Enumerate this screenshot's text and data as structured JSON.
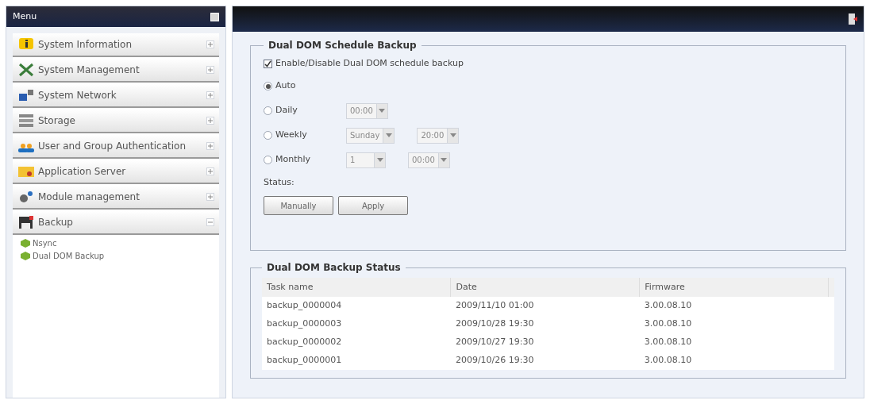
{
  "menu": {
    "title": "Menu",
    "items": [
      {
        "label": "System Information",
        "kind": "info",
        "expanded": false
      },
      {
        "label": "System Management",
        "kind": "tools",
        "expanded": false
      },
      {
        "label": "System Network",
        "kind": "network",
        "expanded": false
      },
      {
        "label": "Storage",
        "kind": "storage",
        "expanded": false
      },
      {
        "label": "User and Group Authentication",
        "kind": "users",
        "expanded": false
      },
      {
        "label": "Application Server",
        "kind": "folder",
        "expanded": false
      },
      {
        "label": "Module management",
        "kind": "gear",
        "expanded": false
      },
      {
        "label": "Backup",
        "kind": "backup",
        "expanded": true,
        "children": [
          {
            "label": "Nsync"
          },
          {
            "label": "Dual DOM Backup"
          }
        ]
      }
    ]
  },
  "schedule": {
    "title": "Dual DOM Schedule Backup",
    "enable": {
      "label": "Enable/Disable Dual DOM schedule backup",
      "checked": true
    },
    "options": [
      {
        "label": "Auto",
        "selected": true
      },
      {
        "label": "Daily",
        "selected": false,
        "selects": [
          "00:00"
        ]
      },
      {
        "label": "Weekly",
        "selected": false,
        "selects": [
          "Sunday",
          "20:00"
        ]
      },
      {
        "label": "Monthly",
        "selected": false,
        "selects": [
          "1",
          "00:00"
        ]
      }
    ],
    "status_label": "Status:",
    "buttons": [
      "Manually",
      "Apply"
    ]
  },
  "status": {
    "title": "Dual DOM Backup Status",
    "columns": [
      "Task name",
      "Date",
      "Firmware"
    ],
    "rows": [
      [
        "backup_0000004",
        "2009/11/10 01:00",
        "3.00.08.10"
      ],
      [
        "backup_0000003",
        "2009/10/28 19:30",
        "3.00.08.10"
      ],
      [
        "backup_0000002",
        "2009/10/27 19:30",
        "3.00.08.10"
      ],
      [
        "backup_0000001",
        "2009/10/26 19:30",
        "3.00.08.10"
      ]
    ]
  }
}
